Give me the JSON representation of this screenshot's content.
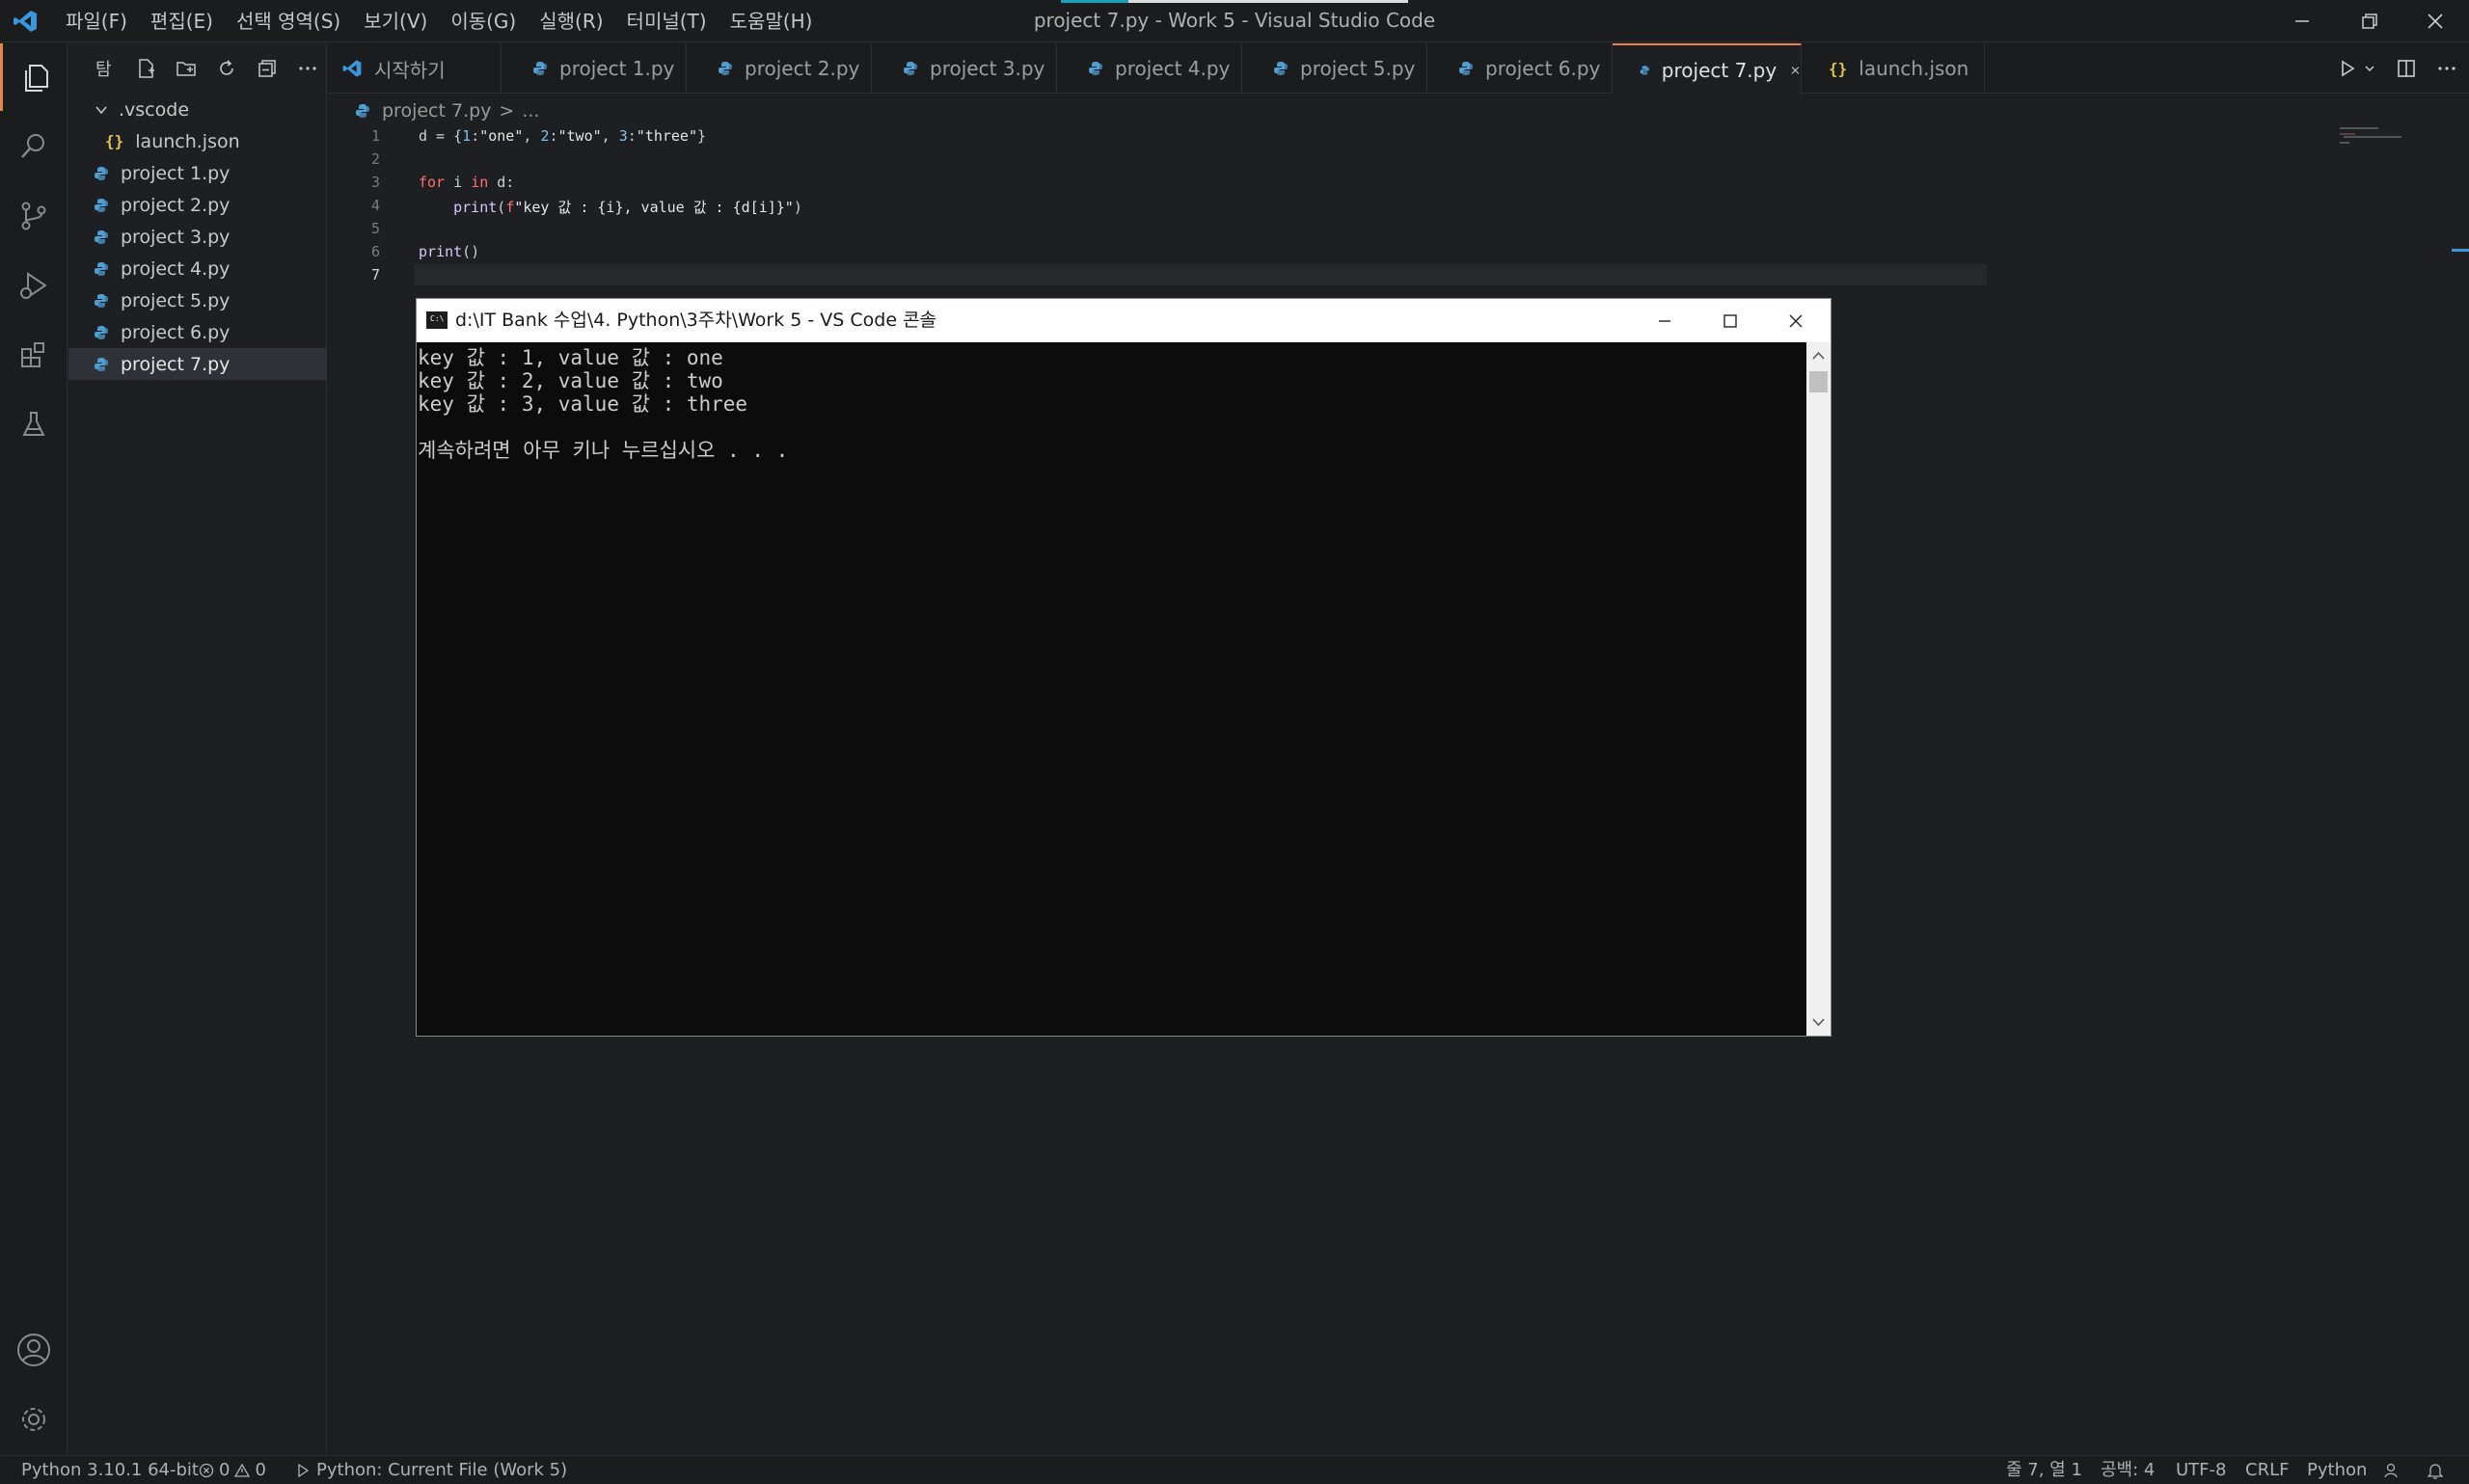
{
  "window": {
    "title": "project 7.py - Work 5 - Visual Studio Code"
  },
  "menu": [
    "파일(F)",
    "편집(E)",
    "선택 영역(S)",
    "보기(V)",
    "이동(G)",
    "실행(R)",
    "터미널(T)",
    "도움말(H)"
  ],
  "sidebar": {
    "title": "탐",
    "tree": [
      {
        "label": ".vscode",
        "kind": "folder",
        "icon": "chevron-down-icon"
      },
      {
        "label": "launch.json",
        "kind": "json",
        "icon": "json-file-icon"
      },
      {
        "label": "project 1.py",
        "kind": "py",
        "icon": "python-file-icon"
      },
      {
        "label": "project 2.py",
        "kind": "py",
        "icon": "python-file-icon"
      },
      {
        "label": "project 3.py",
        "kind": "py",
        "icon": "python-file-icon"
      },
      {
        "label": "project 4.py",
        "kind": "py",
        "icon": "python-file-icon"
      },
      {
        "label": "project 5.py",
        "kind": "py",
        "icon": "python-file-icon"
      },
      {
        "label": "project 6.py",
        "kind": "py",
        "icon": "python-file-icon"
      },
      {
        "label": "project 7.py",
        "kind": "py",
        "icon": "python-file-icon",
        "selected": true
      }
    ]
  },
  "tabs": [
    {
      "label": "시작하기",
      "icon": "vscode-icon"
    },
    {
      "label": "project 1.py",
      "icon": "python-file-icon"
    },
    {
      "label": "project 2.py",
      "icon": "python-file-icon"
    },
    {
      "label": "project 3.py",
      "icon": "python-file-icon"
    },
    {
      "label": "project 4.py",
      "icon": "python-file-icon"
    },
    {
      "label": "project 5.py",
      "icon": "python-file-icon"
    },
    {
      "label": "project 6.py",
      "icon": "python-file-icon"
    },
    {
      "label": "project 7.py",
      "icon": "python-file-icon",
      "active": true
    },
    {
      "label": "launch.json",
      "icon": "json-file-icon"
    }
  ],
  "breadcrumb": {
    "file": "project 7.py",
    "separator": ">",
    "more": "..."
  },
  "editor": {
    "line_numbers": [
      "1",
      "2",
      "3",
      "4",
      "5",
      "6",
      "7"
    ],
    "current_line": "7",
    "lines": [
      "d = {1:\"one\", 2:\"two\", 3:\"three\"}",
      "",
      "for i in d:",
      "    print(f\"key 값 : {i}, value 값 : {d[i]}\")",
      "",
      "print()",
      ""
    ]
  },
  "console": {
    "title": "d:\\IT Bank 수업\\4. Python\\3주차\\Work 5 - VS Code 콘솔",
    "output": [
      "key 값 : 1, value 값 : one",
      "key 값 : 2, value 값 : two",
      "key 값 : 3, value 값 : three",
      "",
      "계속하려면 아무 키나 누르십시오 . . ."
    ]
  },
  "statusbar": {
    "interpreter": "Python 3.10.1 64-bit",
    "errors": "0",
    "warnings": "0",
    "run_config": "Python: Current File (Work 5)",
    "position": "줄 7, 열 1",
    "spaces": "공백: 4",
    "encoding": "UTF-8",
    "eol": "CRLF",
    "language": "Python"
  },
  "colors": {
    "accent": "#e8834d",
    "python_icon": "#4e9fd4",
    "json_icon": "#e3c24a",
    "keyword": "#ff6f6f",
    "number": "#7ec2ef"
  }
}
